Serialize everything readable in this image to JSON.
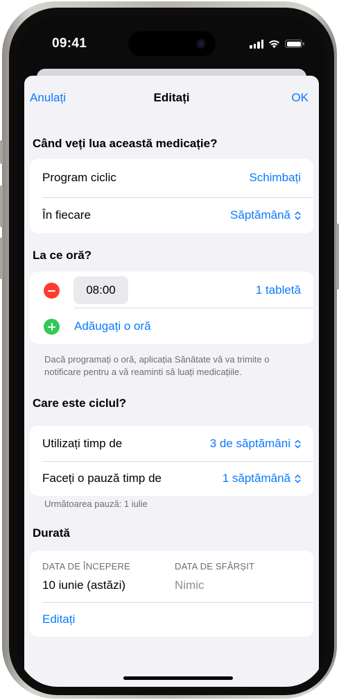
{
  "status_bar": {
    "time": "09:41"
  },
  "nav": {
    "cancel": "Anulați",
    "title": "Editați",
    "done": "OK"
  },
  "when_section": {
    "title": "Când veți lua această medicație?",
    "rows": [
      {
        "label": "Program ciclic",
        "value": "Schimbați"
      },
      {
        "label": "În fiecare",
        "value": "Săptămână"
      }
    ]
  },
  "time_section": {
    "title": "La ce oră?",
    "dose_time": "08:00",
    "dose_amount": "1 tabletă",
    "add_time": "Adăugați o oră",
    "footnote": "Dacă programați o oră, aplicația Sănătate vă va trimite o notificare pentru a vă reaminti să luați medicațiile."
  },
  "cycle_section": {
    "title": "Care este ciclul?",
    "rows": [
      {
        "label": "Utilizați timp de",
        "value": "3 de săptămâni"
      },
      {
        "label": "Faceți o pauză timp de",
        "value": "1 săptămână"
      }
    ],
    "footnote": "Următoarea pauză: 1 iulie"
  },
  "duration_section": {
    "title": "Durată",
    "start_caption": "DATA DE ÎNCEPERE",
    "start_value": "10 iunie (astăzi)",
    "end_caption": "DATA DE SFÂRȘIT",
    "end_value": "Nimic",
    "edit": "Editați"
  },
  "colors": {
    "accent": "#0a7aff",
    "remove": "#ff3b30",
    "add": "#34c759",
    "background": "#f2f2f7",
    "secondary_text": "#6d6d72"
  },
  "icons": [
    "cellular-signal-icon",
    "wifi-icon",
    "battery-icon",
    "remove-circle-icon",
    "add-circle-icon",
    "up-down-chevron-icon"
  ]
}
